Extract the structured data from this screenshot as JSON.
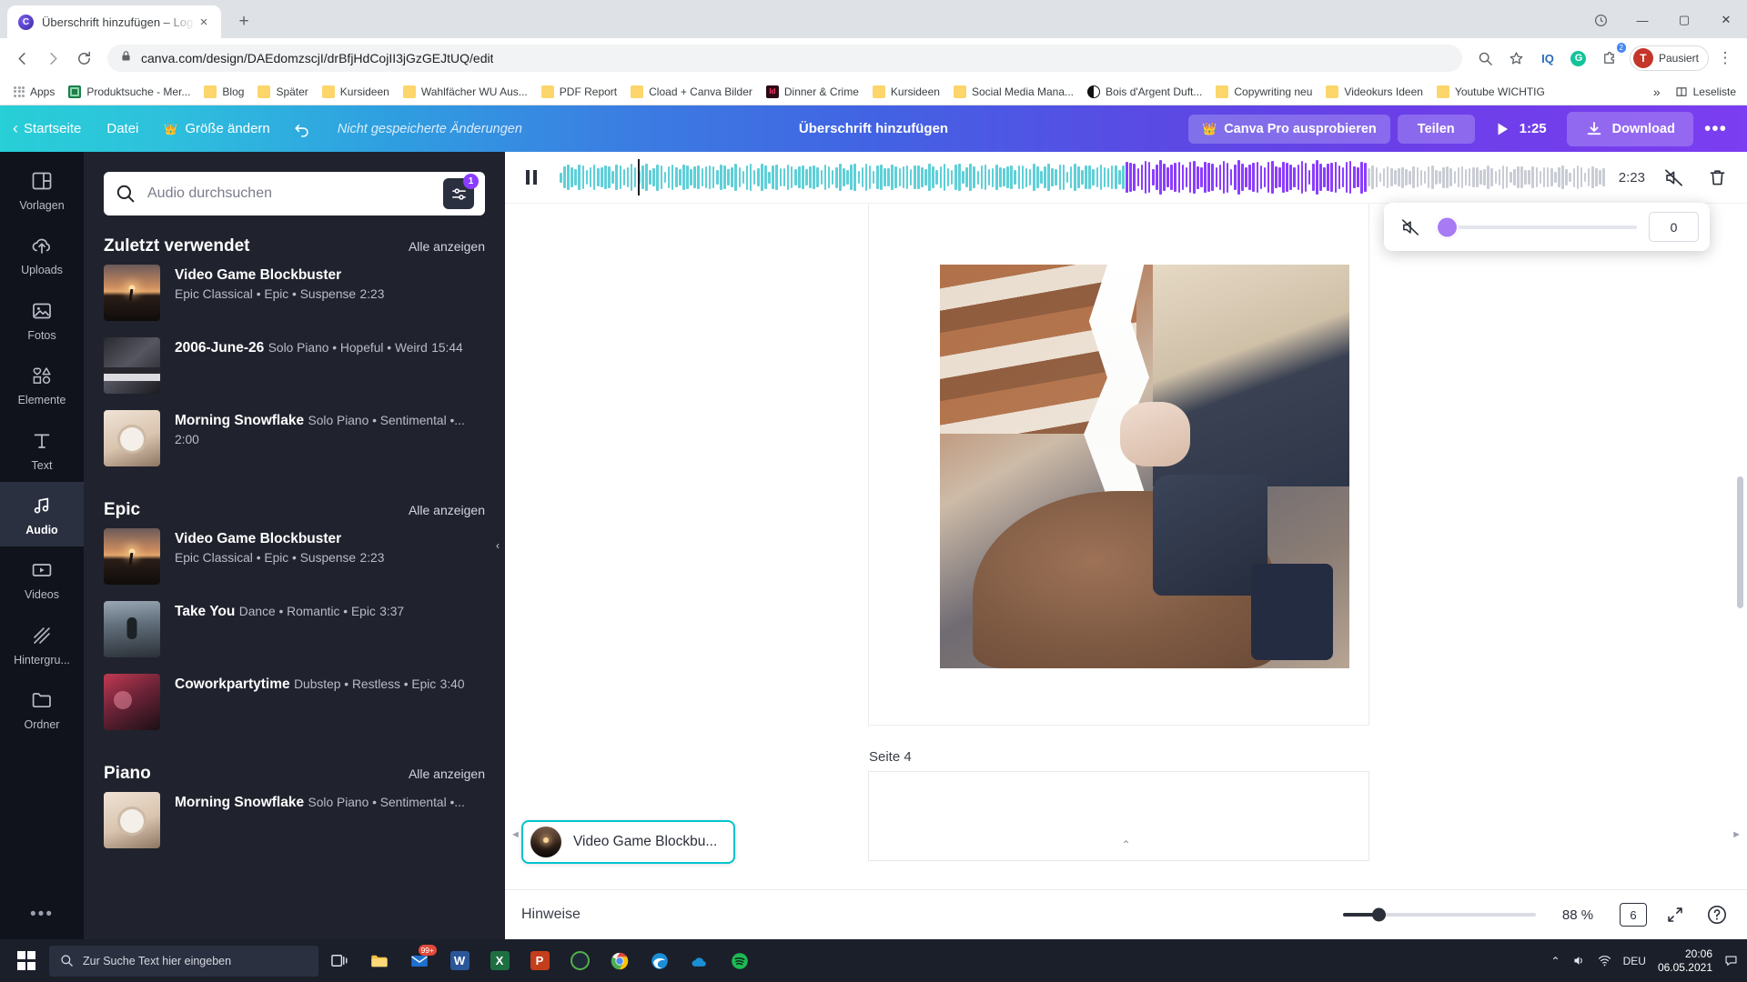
{
  "browser": {
    "tab": {
      "title": "Überschrift hinzufügen – Log",
      "favicon": "canva-icon",
      "close": "×"
    },
    "newtab_label": "+",
    "window_controls": {
      "minimize": "—",
      "maximize": "▢",
      "close": "✕"
    },
    "nav": {
      "back": "←",
      "forward": "→",
      "reload": "⟳"
    },
    "address": {
      "url": "canva.com/design/DAEdomzscjI/drBfjHdCojII3jGzGEJtUQ/edit",
      "lock": "lock-icon",
      "zoom": "zoom-icon",
      "star": "star-icon"
    },
    "extensions": [
      {
        "name": "iq-extension",
        "label": "IQ"
      },
      {
        "name": "grammarly-extension",
        "label": "G"
      },
      {
        "name": "puzzle-extension",
        "count": "2"
      }
    ],
    "profile": {
      "initial": "T",
      "label": "Pausiert"
    },
    "bookmarks": [
      {
        "label": "Apps",
        "icon": "apps-grid-icon"
      },
      {
        "label": "Produktsuche - Mer...",
        "icon": "green-app-icon"
      },
      {
        "label": "Blog",
        "icon": "folder-icon"
      },
      {
        "label": "Später",
        "icon": "folder-icon"
      },
      {
        "label": "Kursideen",
        "icon": "folder-icon"
      },
      {
        "label": "Wahlfächer WU Aus...",
        "icon": "folder-icon"
      },
      {
        "label": "PDF Report",
        "icon": "folder-icon"
      },
      {
        "label": "Cload + Canva Bilder",
        "icon": "folder-icon"
      },
      {
        "label": "Dinner & Crime",
        "icon": "indesign-icon"
      },
      {
        "label": "Kursideen",
        "icon": "folder-icon"
      },
      {
        "label": "Social Media Mana...",
        "icon": "folder-icon"
      },
      {
        "label": "Bois d'Argent Duft...",
        "icon": "dark-circle-icon"
      },
      {
        "label": "Copywriting neu",
        "icon": "folder-icon"
      },
      {
        "label": "Videokurs Ideen",
        "icon": "folder-icon"
      },
      {
        "label": "Youtube WICHTIG",
        "icon": "folder-icon"
      }
    ],
    "bookmarks_overflow": "»",
    "reading_list": "Leseliste"
  },
  "canva_header": {
    "home": "Startseite",
    "file": "Datei",
    "resize": "Größe ändern",
    "undo": "undo-icon",
    "unsaved": "Nicht gespeicherte Änderungen",
    "title": "Überschrift hinzufügen",
    "pro": "Canva Pro ausprobieren",
    "share": "Teilen",
    "play_time": "1:25",
    "download": "Download",
    "more": "•••"
  },
  "rail": {
    "items": [
      {
        "label": "Vorlagen",
        "icon": "templates-icon",
        "active": false
      },
      {
        "label": "Uploads",
        "icon": "upload-cloud-icon",
        "active": false
      },
      {
        "label": "Fotos",
        "icon": "photo-icon",
        "active": false
      },
      {
        "label": "Elemente",
        "icon": "shapes-icon",
        "active": false
      },
      {
        "label": "Text",
        "icon": "text-icon",
        "active": false
      },
      {
        "label": "Audio",
        "icon": "music-note-icon",
        "active": true
      },
      {
        "label": "Videos",
        "icon": "video-icon",
        "active": false
      },
      {
        "label": "Hintergru...",
        "icon": "background-icon",
        "active": false
      },
      {
        "label": "Ordner",
        "icon": "folder-icon",
        "active": false
      }
    ],
    "more": "•••"
  },
  "panel": {
    "search_placeholder": "Audio durchsuchen",
    "search_value": "",
    "filter_badge": "1",
    "sections": [
      {
        "title": "Zuletzt verwendet",
        "see_all": "Alle anzeigen",
        "tracks": [
          {
            "name": "Video Game Blockbuster",
            "tags": "Epic Classical • Epic • Suspense",
            "duration": "2:23",
            "thumb": "sunset"
          },
          {
            "name": "2006-June-26",
            "tags": "Solo Piano • Hopeful • Weird",
            "duration": "15:44",
            "thumb": "piano"
          },
          {
            "name": "Morning Snowflake",
            "tags": "Solo Piano • Sentimental •...",
            "duration": "2:00",
            "thumb": "coffee"
          }
        ]
      },
      {
        "title": "Epic",
        "see_all": "Alle anzeigen",
        "tracks": [
          {
            "name": "Video Game Blockbuster",
            "tags": "Epic Classical • Epic • Suspense",
            "duration": "2:23",
            "thumb": "sunset"
          },
          {
            "name": "Take You",
            "tags": "Dance • Romantic • Epic",
            "duration": "3:37",
            "thumb": "person"
          },
          {
            "name": "Coworkpartytime",
            "tags": "Dubstep • Restless • Epic",
            "duration": "3:40",
            "thumb": "party"
          }
        ]
      },
      {
        "title": "Piano",
        "see_all": "Alle anzeigen",
        "tracks": [
          {
            "name": "Morning Snowflake",
            "tags": "Solo Piano • Sentimental •...",
            "duration": "",
            "thumb": "coffee"
          }
        ]
      }
    ],
    "collapse": "‹"
  },
  "audio_bar": {
    "pause": "pause-icon",
    "total_time": "2:23",
    "mute": "mute-icon",
    "delete": "trash-icon"
  },
  "volume_popup": {
    "mute_icon": "mute-icon",
    "value": "0",
    "slider_position": 0
  },
  "canvas": {
    "page_label": "Seite 4",
    "audio_chip": "Video Game Blockbu...",
    "scroll_left": "◄",
    "scroll_right": "►",
    "notes_caret": "⌃"
  },
  "statusbar": {
    "notes": "Hinweise",
    "zoom": "88 %",
    "page_count": "6",
    "fullscreen": "expand-icon",
    "help": "?"
  },
  "taskbar": {
    "start": "windows-logo",
    "search_placeholder": "Zur Suche Text hier eingeben",
    "apps": [
      {
        "name": "task-view",
        "icon": "taskview-icon"
      },
      {
        "name": "file-explorer",
        "icon": "folder-icon"
      },
      {
        "name": "mail",
        "icon": "mail-icon",
        "badge": "99+"
      },
      {
        "name": "word",
        "icon": "word-icon",
        "label": "W"
      },
      {
        "name": "excel",
        "icon": "excel-icon",
        "label": "X"
      },
      {
        "name": "powerpoint",
        "icon": "powerpoint-icon",
        "label": "P"
      },
      {
        "name": "camtasia",
        "icon": "camtasia-icon"
      },
      {
        "name": "chrome",
        "icon": "chrome-icon"
      },
      {
        "name": "edge",
        "icon": "edge-icon"
      },
      {
        "name": "onedrive",
        "icon": "onedrive-icon"
      },
      {
        "name": "spotify",
        "icon": "spotify-icon"
      }
    ],
    "tray": {
      "chevron": "⌃",
      "volume": "volume-icon",
      "network": "network-icon",
      "language": "DEU",
      "time": "20:06",
      "date": "06.05.2021",
      "notifications": "notification-icon"
    }
  },
  "colors": {
    "accent_teal": "#00c4cc",
    "accent_purple": "#8b3dff",
    "wave_teal": "#5ed0d8",
    "wave_purple": "#8b3dff",
    "wave_gray": "#c9ccd4",
    "panel_bg": "#20232e",
    "rail_bg": "#10131c"
  }
}
